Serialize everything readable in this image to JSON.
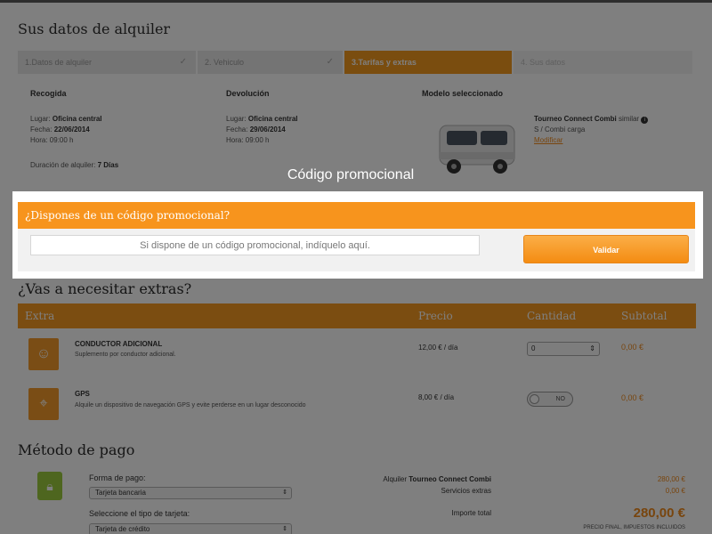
{
  "page": {
    "title": "Sus datos de alquiler"
  },
  "steps": [
    {
      "label": "1.Datos de alquiler"
    },
    {
      "label": "2. Vehiculo"
    },
    {
      "label": "3.Tarifas y extras"
    },
    {
      "label": "4. Sus datos"
    }
  ],
  "pickup": {
    "title": "Recogida",
    "lugar_label": "Lugar:",
    "lugar": "Oficina central",
    "fecha_label": "Fecha:",
    "fecha": "22/06/2014",
    "hora_label": "Hora:",
    "hora": "09:00 h",
    "duration_label": "Duración de alquiler:",
    "duration": "7 Días"
  },
  "return": {
    "title": "Devolución",
    "lugar_label": "Lugar:",
    "lugar": "Oficina central",
    "fecha_label": "Fecha:",
    "fecha": "29/06/2014",
    "hora_label": "Hora:",
    "hora": "09:00 h"
  },
  "model": {
    "title": "Modelo seleccionado",
    "name": "Tourneo Connect Combi",
    "similar": "similar",
    "category": "S / Combi carga",
    "modify": "Modificar"
  },
  "overlay": {
    "title": "Código promocional"
  },
  "promo": {
    "header": "¿Dispones de un código promocional?",
    "placeholder": "Si dispone de un código promocional, indíquelo aquí.",
    "button": "Validar"
  },
  "extras": {
    "title": "¿Vas a necesitar extras?",
    "columns": {
      "extra": "Extra",
      "precio": "Precio",
      "cantidad": "Cantidad",
      "subtotal": "Subtotal"
    },
    "rows": [
      {
        "name": "CONDUCTOR ADICIONAL",
        "desc": "Suplemento por conductor adicional.",
        "price": "12,00 € / día",
        "qty": "0",
        "subtotal": "0,00 €"
      },
      {
        "name": "GPS",
        "desc": "Alquile un dispositivo de navegación GPS y evite perderse en un lugar desconocido",
        "price": "8,00 € / día",
        "toggle": "NO",
        "subtotal": "0,00 €"
      }
    ]
  },
  "payment": {
    "title": "Método de pago",
    "form_label": "Forma de pago:",
    "form_value": "Tarjeta bancaria",
    "card_label": "Seleccione el tipo de tarjeta:",
    "card_value": "Tarjeta de crédito",
    "summary": {
      "rental_label_prefix": "Alquiler",
      "rental_label_model": "Tourneo Connect Combi",
      "rental_value": "280,00 €",
      "services_label": "Servicios extras",
      "services_value": "0,00 €",
      "total_label": "Importe total",
      "total_value": "280,00 €",
      "final_note": "PRECIO FINAL, IMPUESTOS INCLUIDOS"
    }
  },
  "colors": {
    "accent": "#f7941d",
    "payment_icon": "#9ccc3f"
  }
}
